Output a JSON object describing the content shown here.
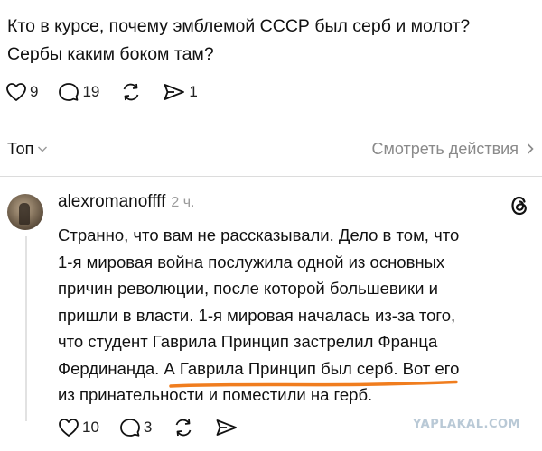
{
  "post": {
    "line1": "Кто в курсе, почему эмблемой СССР был серб и молот?",
    "line2": "Сербы каким боком там?",
    "likes": "9",
    "comments": "19",
    "shares": "1"
  },
  "sort": {
    "label": "Топ",
    "action": "Смотреть действия"
  },
  "comment": {
    "username": "alexromanoffff",
    "time": "2 ч.",
    "lines": [
      "Странно, что вам не рассказывали. Дело в том, что",
      "1-я мировая война послужила одной из основных",
      "причин революции, после которой большевики и",
      "пришли в власти. 1-я мировая началась из-за того,",
      "что студент Гаврила Принцип застрелил Франца",
      "Фердинанда. А Гаврила Принцип был серб. Вот его",
      "из принательности и поместили на герб."
    ],
    "likes": "10",
    "comments": "3"
  },
  "colors": {
    "text": "#111111",
    "muted": "#8a8a8a",
    "underline": "#f07d1e",
    "watermark": "#b9c9d6"
  },
  "icons": {
    "like": "heart-icon",
    "comment": "comment-bubble-icon",
    "repost": "repost-icon",
    "share": "share-send-icon",
    "dropdown": "chevron-down-icon",
    "more": "chevron-right-icon",
    "app": "threads-logo-icon"
  },
  "watermark": "YAPLAKAL.COM"
}
